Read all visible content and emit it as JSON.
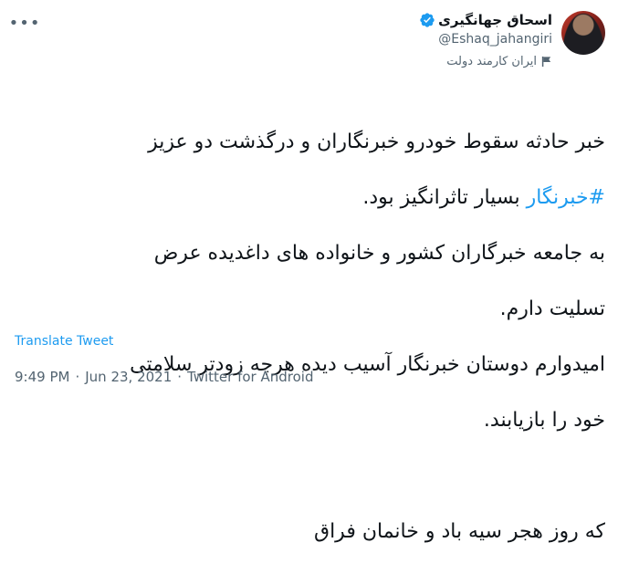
{
  "author": {
    "name": "اسحاق جهانگیری",
    "handle": "@Eshaq_jahangiri",
    "label": "ایران کارمند دولت"
  },
  "tweet": {
    "line1": "خبر حادثه سقوط خودرو خبرنگاران و درگذشت دو عزیز",
    "hashtag": "#خبرنگار",
    "line2_rest": " بسیار تاثرانگیز بود.",
    "line3": "به جامعه خبرگاران کشور و خانواده های داغدیده عرض",
    "line4": "تسلیت دارم.",
    "line5": "امیدوارم دوستان خبرنگار آسیب دیده هرچه زودتر سلامتی",
    "line6": "خود را بازیابند.",
    "line7": "که روز هجر سیه باد و خانمان فراق"
  },
  "translate_label": "Translate Tweet",
  "meta": {
    "time": "9:49 PM",
    "date": "Jun 23, 2021",
    "source": "Twitter for Android",
    "separator": "·"
  },
  "colors": {
    "accent": "#1d9bf0",
    "secondary_text": "#536471",
    "text": "#0f1419"
  },
  "icons": {
    "more": "more-icon",
    "verified": "verified-badge-icon",
    "label": "flag-icon"
  }
}
